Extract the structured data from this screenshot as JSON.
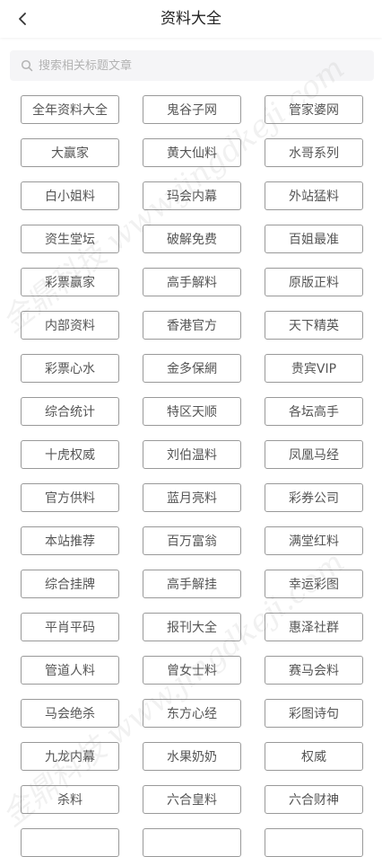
{
  "header": {
    "title": "资料大全",
    "back_icon": "chevron-left-icon"
  },
  "search": {
    "placeholder": "搜索相关标题文章",
    "icon": "search-icon"
  },
  "categories": [
    "全年资料大全",
    "鬼谷子网",
    "管家婆网",
    "大赢家",
    "黄大仙料",
    "水哥系列",
    "白小姐料",
    "玛会内幕",
    "外站猛料",
    "资生堂坛",
    "破解免费",
    "百姐最准",
    "彩票赢家",
    "高手解料",
    "原版正料",
    "内部资料",
    "香港官方",
    "天下精英",
    "彩票心水",
    "金多保網",
    "贵宾VIP",
    "综合统计",
    "特区天顺",
    "各坛高手",
    "十虎权威",
    "刘伯温料",
    "凤凰马经",
    "官方供料",
    "蓝月亮料",
    "彩券公司",
    "本站推荐",
    "百万富翁",
    "满堂红料",
    "综合挂牌",
    "高手解挂",
    "幸运彩图",
    "平肖平码",
    "报刊大全",
    "惠泽社群",
    "管道人料",
    "曾女士料",
    "赛马会料",
    "马会绝杀",
    "东方心经",
    "彩图诗句",
    "九龙内幕",
    "水果奶奶",
    "权威",
    "杀料",
    "六合皇料",
    "六合财神",
    "",
    "",
    ""
  ],
  "watermarks": [
    "金鼎科技 www.jingdkeji.com",
    "金鼎科技 www.jingdkeji.com"
  ],
  "colors": {
    "tag_border": "#999999",
    "tag_text": "#555555",
    "search_bg": "#f5f5f7",
    "placeholder": "#b3b3b3"
  }
}
